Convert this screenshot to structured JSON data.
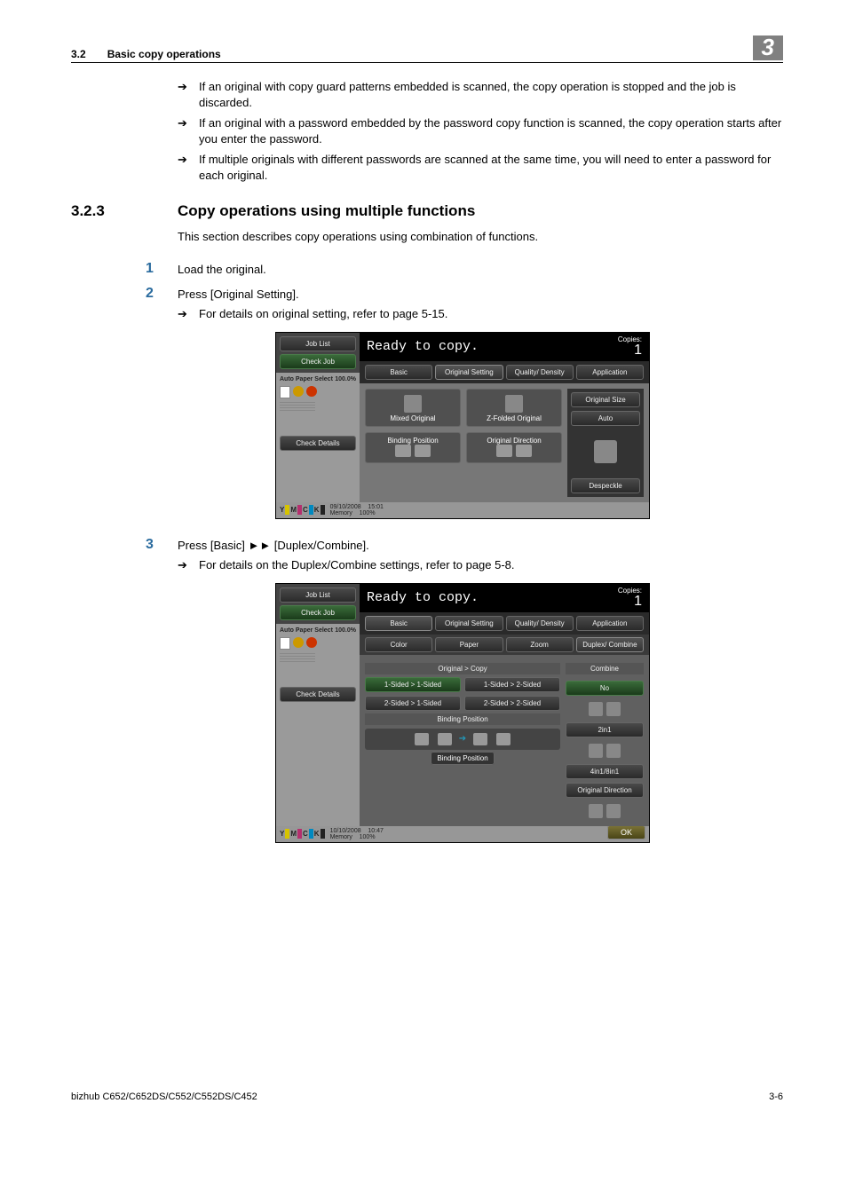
{
  "header": {
    "section": "3.2",
    "title": "Basic copy operations",
    "chapter": "3"
  },
  "intro_bullets": [
    "If an original with copy guard patterns embedded is scanned, the copy operation is stopped and the job is discarded.",
    "If an original with a password embedded by the password copy function is scanned, the copy operation starts after you enter the password.",
    "If multiple originals with different passwords are scanned at the same time, you will need to enter a password for each original."
  ],
  "h3": {
    "num": "3.2.3",
    "title": "Copy operations using multiple functions"
  },
  "intro": "This section describes copy operations using combination of functions.",
  "step1": {
    "n": "1",
    "text": "Load the original."
  },
  "step2": {
    "n": "2",
    "text": "Press [Original Setting].",
    "sub": "For details on original setting, refer to page 5-15."
  },
  "step3": {
    "n": "3",
    "text": "Press [Basic] ►► [Duplex/Combine].",
    "sub": "For details on the Duplex/Combine settings, refer to page 5-8."
  },
  "arrow_glyph": "➔",
  "screen1": {
    "title": "Ready to copy.",
    "copies_label": "Copies:",
    "copies": "1",
    "left": {
      "job_list": "Job List",
      "check_job": "Check Job",
      "auto_paper": "Auto Paper Select",
      "pct": "100.0%",
      "check_details": "Check Details"
    },
    "tabs": [
      "Basic",
      "Original Setting",
      "Quality/ Density",
      "Application"
    ],
    "panels": {
      "mixed": "Mixed Original",
      "zfold": "Z-Folded Original",
      "binding": "Binding Position",
      "direction": "Original Direction",
      "orig_size": "Original Size",
      "auto": "Auto",
      "despeckle": "Despeckle"
    },
    "foot": {
      "date": "09/10/2008",
      "time": "15:01",
      "mem": "Memory",
      "pct": "100%"
    }
  },
  "screen2": {
    "title": "Ready to copy.",
    "copies_label": "Copies:",
    "copies": "1",
    "left": {
      "job_list": "Job List",
      "check_job": "Check Job",
      "auto_paper": "Auto Paper Select",
      "pct": "100.0%",
      "check_details": "Check Details"
    },
    "tabs": [
      "Basic",
      "Original Setting",
      "Quality/ Density",
      "Application"
    ],
    "subtabs": [
      "Color",
      "Paper",
      "Zoom",
      "Duplex/ Combine"
    ],
    "orig_copy": "Original > Copy",
    "combine": "Combine",
    "dup": [
      "1-Sided > 1-Sided",
      "1-Sided > 2-Sided",
      "2-Sided > 1-Sided",
      "2-Sided > 2-Sided"
    ],
    "no": "No",
    "two_in_one": "2in1",
    "four_eight": "4in1/8in1",
    "binding_header": "Binding Position",
    "binding_btn": "Binding Position",
    "orig_dir": "Original Direction",
    "ok": "OK",
    "foot": {
      "date": "10/10/2008",
      "time": "10:47",
      "mem": "Memory",
      "pct": "100%"
    }
  },
  "footer": {
    "left": "bizhub C652/C652DS/C552/C552DS/C452",
    "right": "3-6"
  }
}
